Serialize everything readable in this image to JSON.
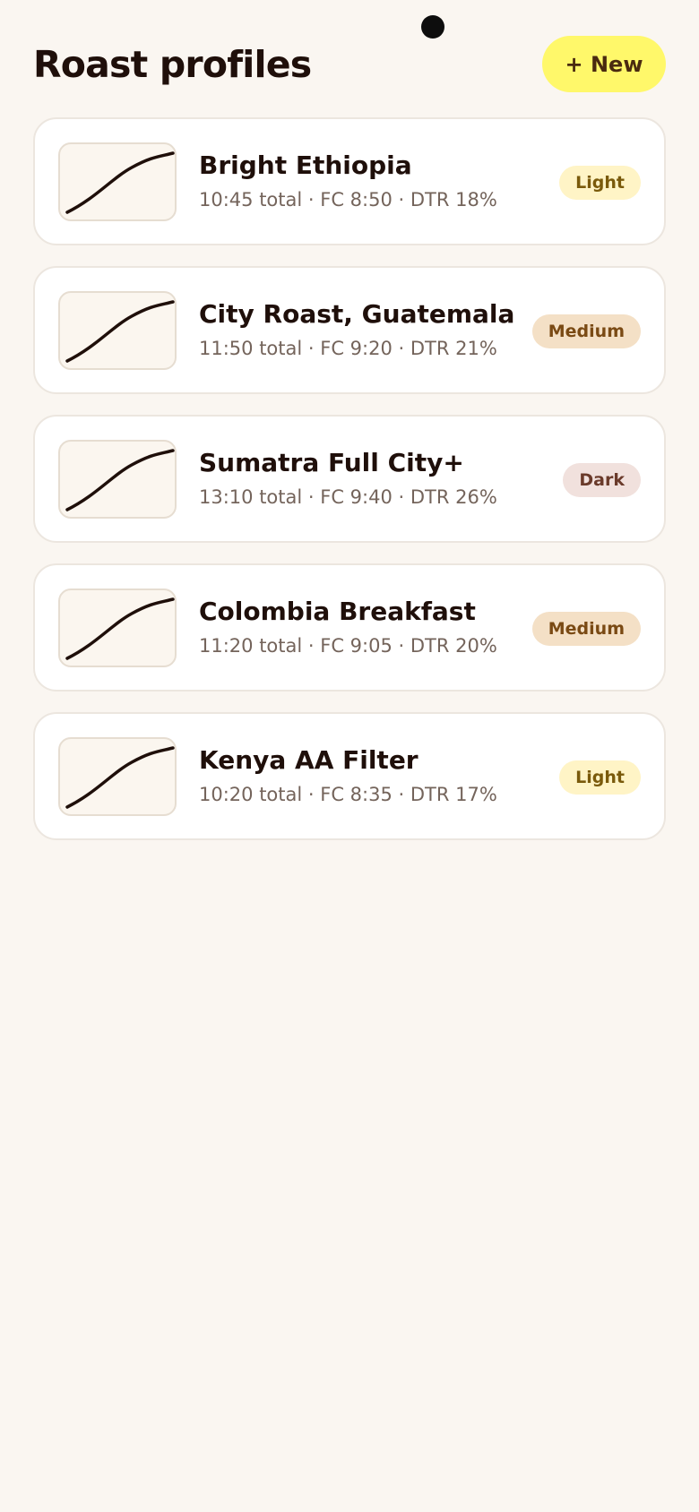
{
  "header": {
    "title": "Roast profiles",
    "new_button_label": "+ New"
  },
  "profiles": [
    {
      "name": "Bright Ethiopia",
      "meta": "10:45 total · FC 8:50 · DTR 18%",
      "level": "Light"
    },
    {
      "name": "City Roast, Guatemala",
      "meta": "11:50 total · FC 9:20 · DTR 21%",
      "level": "Medium"
    },
    {
      "name": "Sumatra Full City+",
      "meta": "13:10 total · FC 9:40 · DTR 26%",
      "level": "Dark"
    },
    {
      "name": "Colombia Breakfast",
      "meta": "11:20 total · FC 9:05 · DTR 20%",
      "level": "Medium"
    },
    {
      "name": "Kenya AA Filter",
      "meta": "10:20 total · FC 8:35 · DTR 17%",
      "level": "Light"
    }
  ],
  "colors": {
    "background": "#faf6f1",
    "accent": "#fff86a",
    "text": "#1f0f0a",
    "light_badge": "#fff4c6",
    "medium_badge": "#f4e0c6",
    "dark_badge": "#f1e1dd"
  },
  "icons": {
    "thumbnail": "roast-curve-icon"
  }
}
